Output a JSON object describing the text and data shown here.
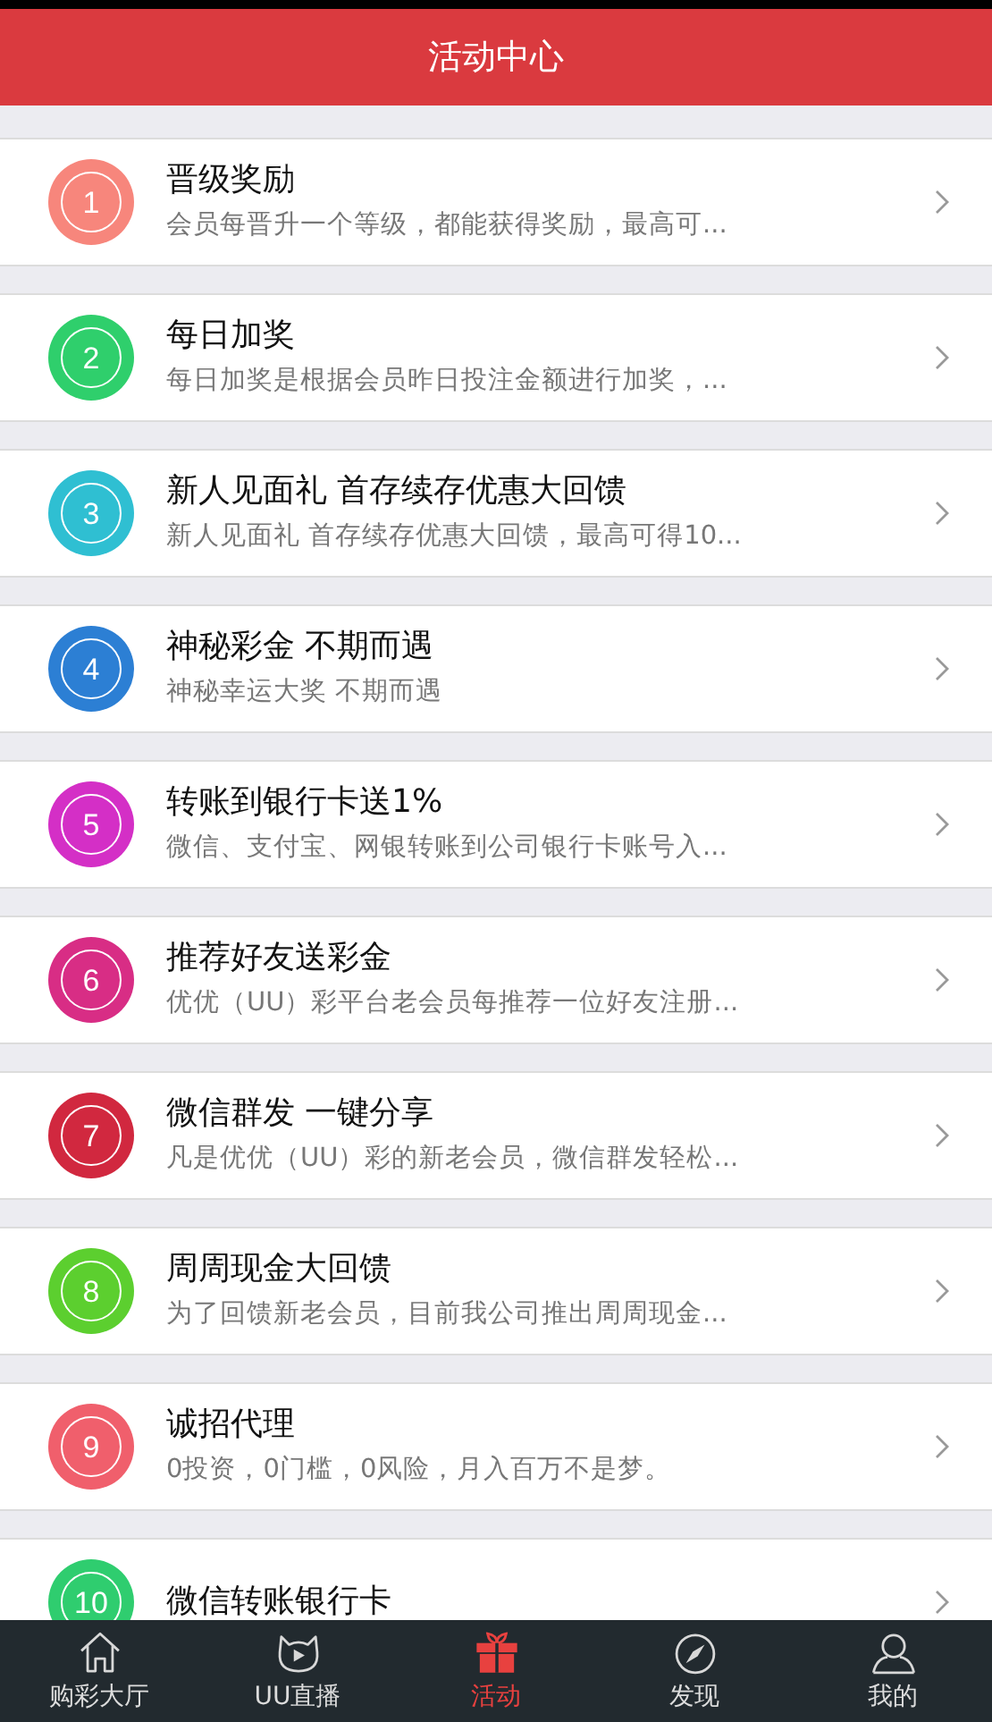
{
  "header": {
    "title": "活动中心"
  },
  "activities": [
    {
      "number": "1",
      "color": "#f7867c",
      "title": "晋级奖励",
      "subtitle": "会员每晋升一个等级，都能获得奖励，最高可..."
    },
    {
      "number": "2",
      "color": "#2fcf6c",
      "title": "每日加奖",
      "subtitle": "每日加奖是根据会员昨日投注金额进行加奖，..."
    },
    {
      "number": "3",
      "color": "#2fbfd2",
      "title": "新人见面礼 首存续存优惠大回馈",
      "subtitle": "新人见面礼 首存续存优惠大回馈，最高可得10..."
    },
    {
      "number": "4",
      "color": "#2c7fd4",
      "title": "神秘彩金 不期而遇",
      "subtitle": "神秘幸运大奖 不期而遇"
    },
    {
      "number": "5",
      "color": "#d42fc6",
      "title": "转账到银行卡送1%",
      "subtitle": "微信、支付宝、网银转账到公司银行卡账号入..."
    },
    {
      "number": "6",
      "color": "#d82d85",
      "title": "推荐好友送彩金",
      "subtitle": "优优（UU）彩平台老会员每推荐一位好友注册..."
    },
    {
      "number": "7",
      "color": "#d1283f",
      "title": "微信群发 一键分享",
      "subtitle": "凡是优优（UU）彩的新老会员，微信群发轻松..."
    },
    {
      "number": "8",
      "color": "#5ccf2f",
      "title": "周周现金大回馈",
      "subtitle": "为了回馈新老会员，目前我公司推出周周现金..."
    },
    {
      "number": "9",
      "color": "#f05f6c",
      "title": "诚招代理",
      "subtitle": "0投资，0门槛，0风险，月入百万不是梦。"
    },
    {
      "number": "10",
      "color": "#2fcd6f",
      "title": "微信转账银行卡"
    }
  ],
  "tab_bar": [
    {
      "label": "购彩大厅",
      "selected": false
    },
    {
      "label": "UU直播",
      "selected": false
    },
    {
      "label": "活动",
      "selected": true
    },
    {
      "label": "发现",
      "selected": false
    },
    {
      "label": "我的",
      "selected": false
    }
  ]
}
